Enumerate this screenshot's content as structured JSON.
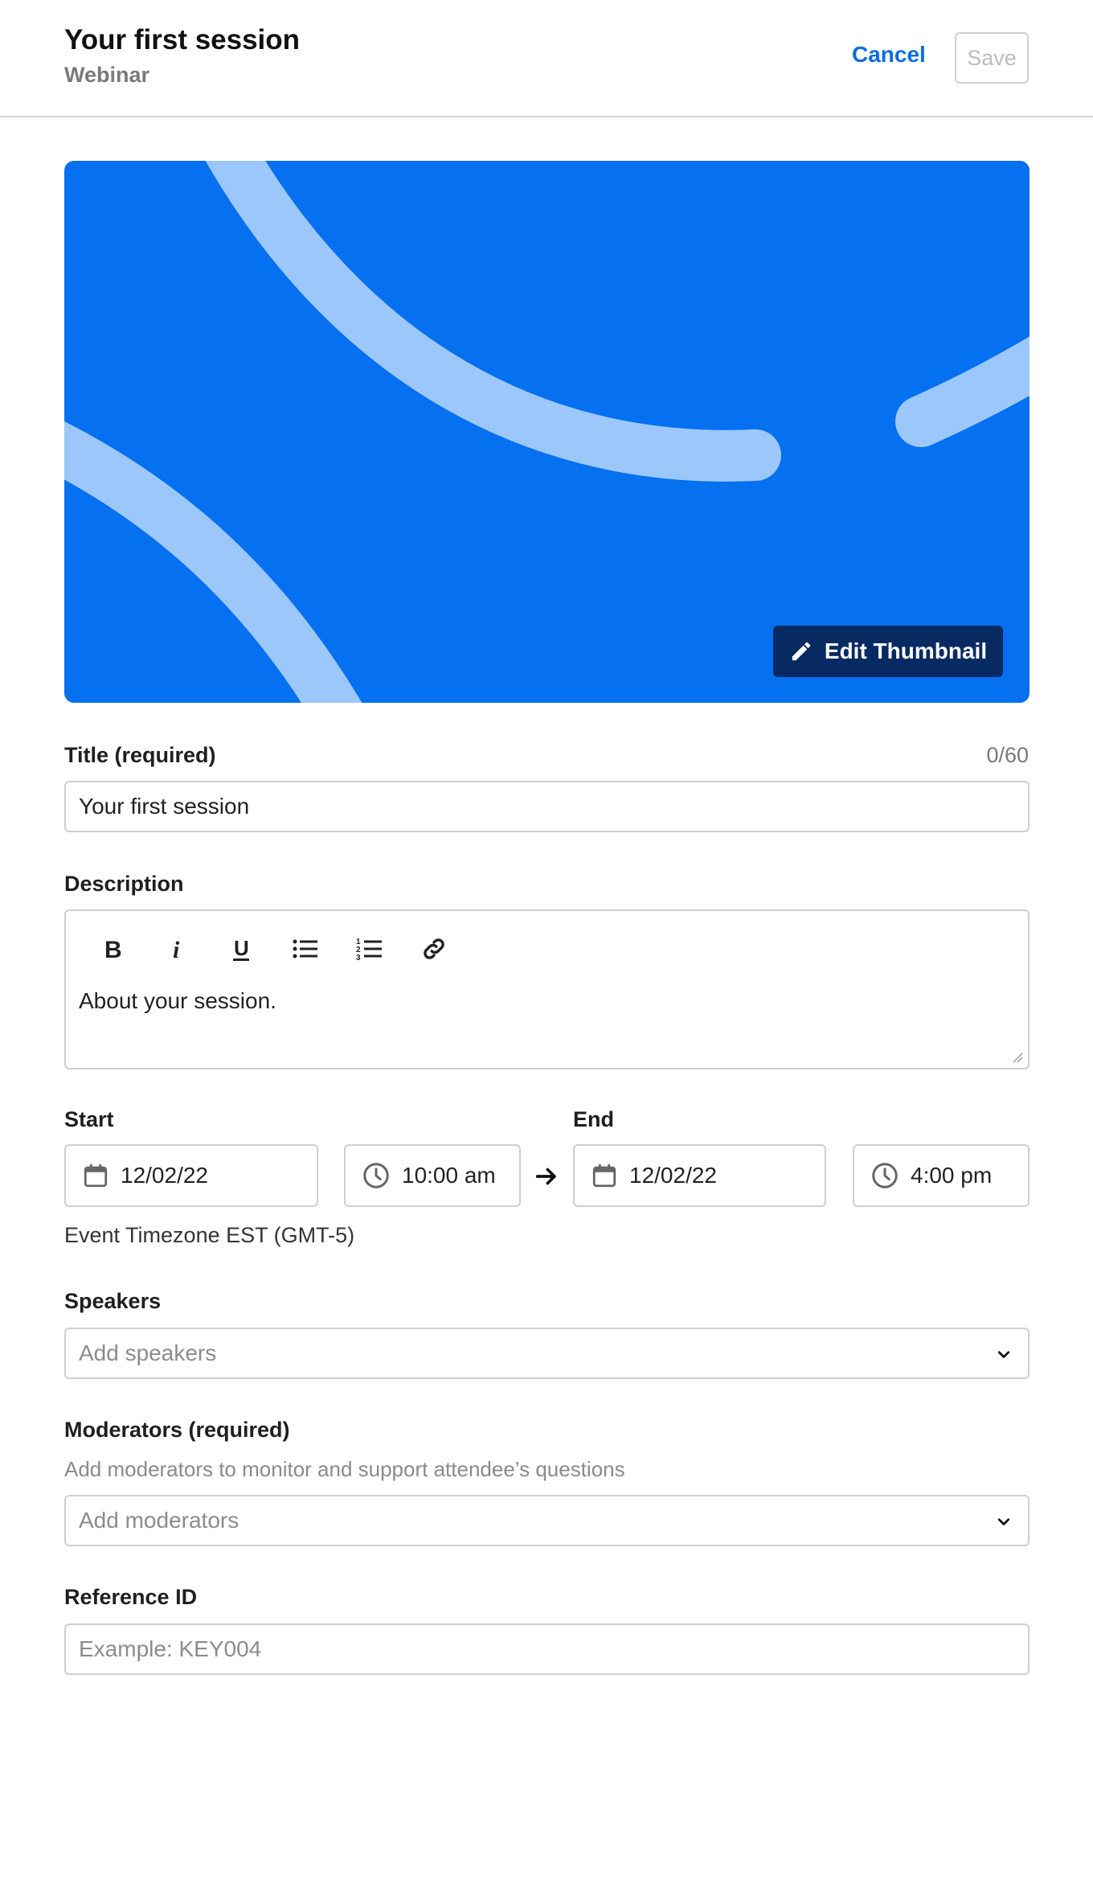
{
  "header": {
    "title": "Your first session",
    "subtitle": "Webinar",
    "cancel_label": "Cancel",
    "save_label": "Save"
  },
  "thumbnail": {
    "edit_label": "Edit Thumbnail",
    "background_color": "#0570f0",
    "stroke_color": "#9cc7fb",
    "button_color": "#072a63"
  },
  "title_field": {
    "label": "Title (required)",
    "counter": "0/60",
    "value": "Your first session"
  },
  "description": {
    "label": "Description",
    "value": "About your session.",
    "toolbar": [
      "bold-icon",
      "italic-icon",
      "underline-icon",
      "bulleted-list-icon",
      "numbered-list-icon",
      "link-icon"
    ]
  },
  "schedule": {
    "start_label": "Start",
    "end_label": "End",
    "start_date": "12/02/22",
    "start_time": "10:00 am",
    "end_date": "12/02/22",
    "end_time": "4:00 pm",
    "timezone": "Event Timezone EST (GMT-5)"
  },
  "speakers": {
    "label": "Speakers",
    "placeholder": "Add speakers"
  },
  "moderators": {
    "label": "Moderators (required)",
    "helper": "Add moderators to monitor and support attendee’s questions",
    "placeholder": "Add moderators"
  },
  "reference": {
    "label": "Reference ID",
    "placeholder": "Example: KEY004"
  },
  "colors": {
    "accent": "#0a6de0"
  }
}
